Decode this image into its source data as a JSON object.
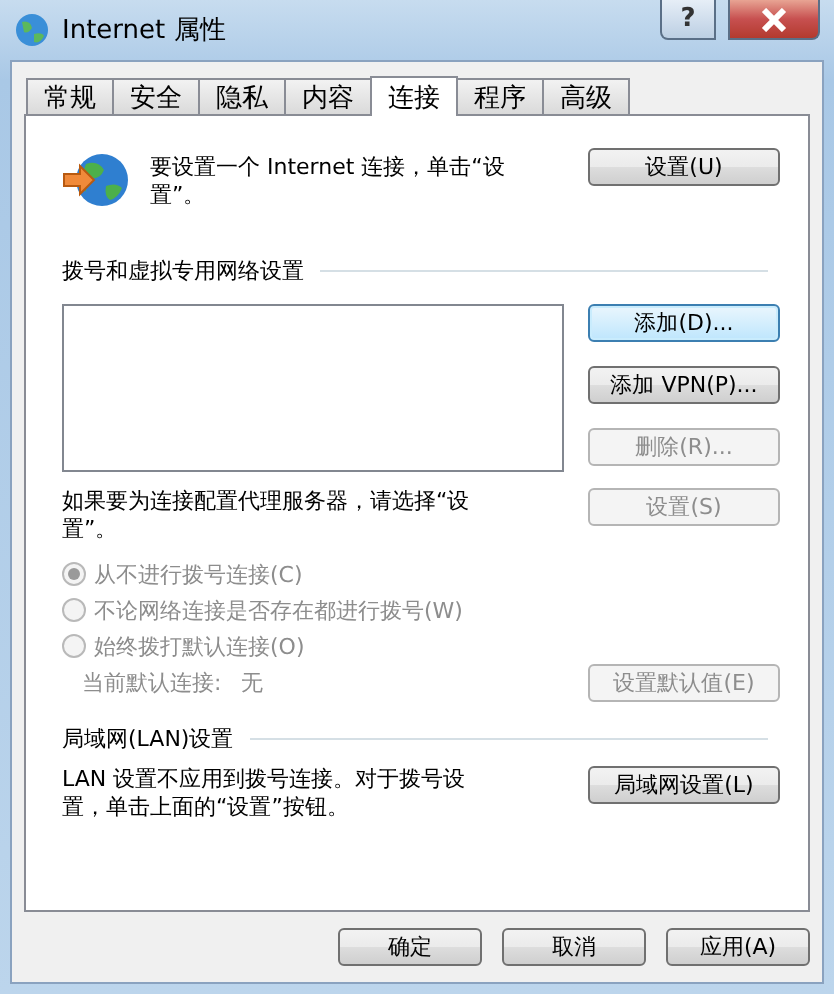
{
  "window": {
    "title": "Internet 属性",
    "help_button": "?"
  },
  "tabs": [
    {
      "label": "常规",
      "selected": false
    },
    {
      "label": "安全",
      "selected": false
    },
    {
      "label": "隐私",
      "selected": false
    },
    {
      "label": "内容",
      "selected": false
    },
    {
      "label": "连接",
      "selected": true
    },
    {
      "label": "程序",
      "selected": false
    },
    {
      "label": "高级",
      "selected": false
    }
  ],
  "setup": {
    "text": "要设置一个 Internet 连接，单击“设置”。",
    "button": {
      "label": "设置(U)",
      "disabled": false,
      "focused": false
    }
  },
  "dialup": {
    "heading": "拨号和虚拟专用网络设置",
    "buttons": [
      {
        "label": "添加(D)...",
        "disabled": false,
        "focused": true
      },
      {
        "label": "添加 VPN(P)...",
        "disabled": false,
        "focused": false
      },
      {
        "label": "删除(R)...",
        "disabled": true,
        "focused": false
      }
    ],
    "proxy_text": "如果要为连接配置代理服务器，请选择“设置”。",
    "proxy_button": {
      "label": "设置(S)",
      "disabled": true,
      "focused": false
    },
    "options": [
      {
        "label": "从不进行拨号连接(C)",
        "selected": true,
        "disabled": true
      },
      {
        "label": "不论网络连接是否存在都进行拨号(W)",
        "selected": false,
        "disabled": true
      },
      {
        "label": "始终拨打默认连接(O)",
        "selected": false,
        "disabled": true
      }
    ],
    "default_label": "当前默认连接:",
    "default_value": "无",
    "default_button": {
      "label": "设置默认值(E)",
      "disabled": true,
      "focused": false
    }
  },
  "lan": {
    "heading": "局域网(LAN)设置",
    "text": "LAN 设置不应用到拨号连接。对于拨号设置，单击上面的“设置”按钮。",
    "button": {
      "label": "局域网设置(L)",
      "disabled": false,
      "focused": false
    }
  },
  "footer": [
    {
      "label": "确定",
      "disabled": false,
      "focused": false
    },
    {
      "label": "取消",
      "disabled": false,
      "focused": false
    },
    {
      "label": "应用(A)",
      "disabled": false,
      "focused": false
    }
  ]
}
